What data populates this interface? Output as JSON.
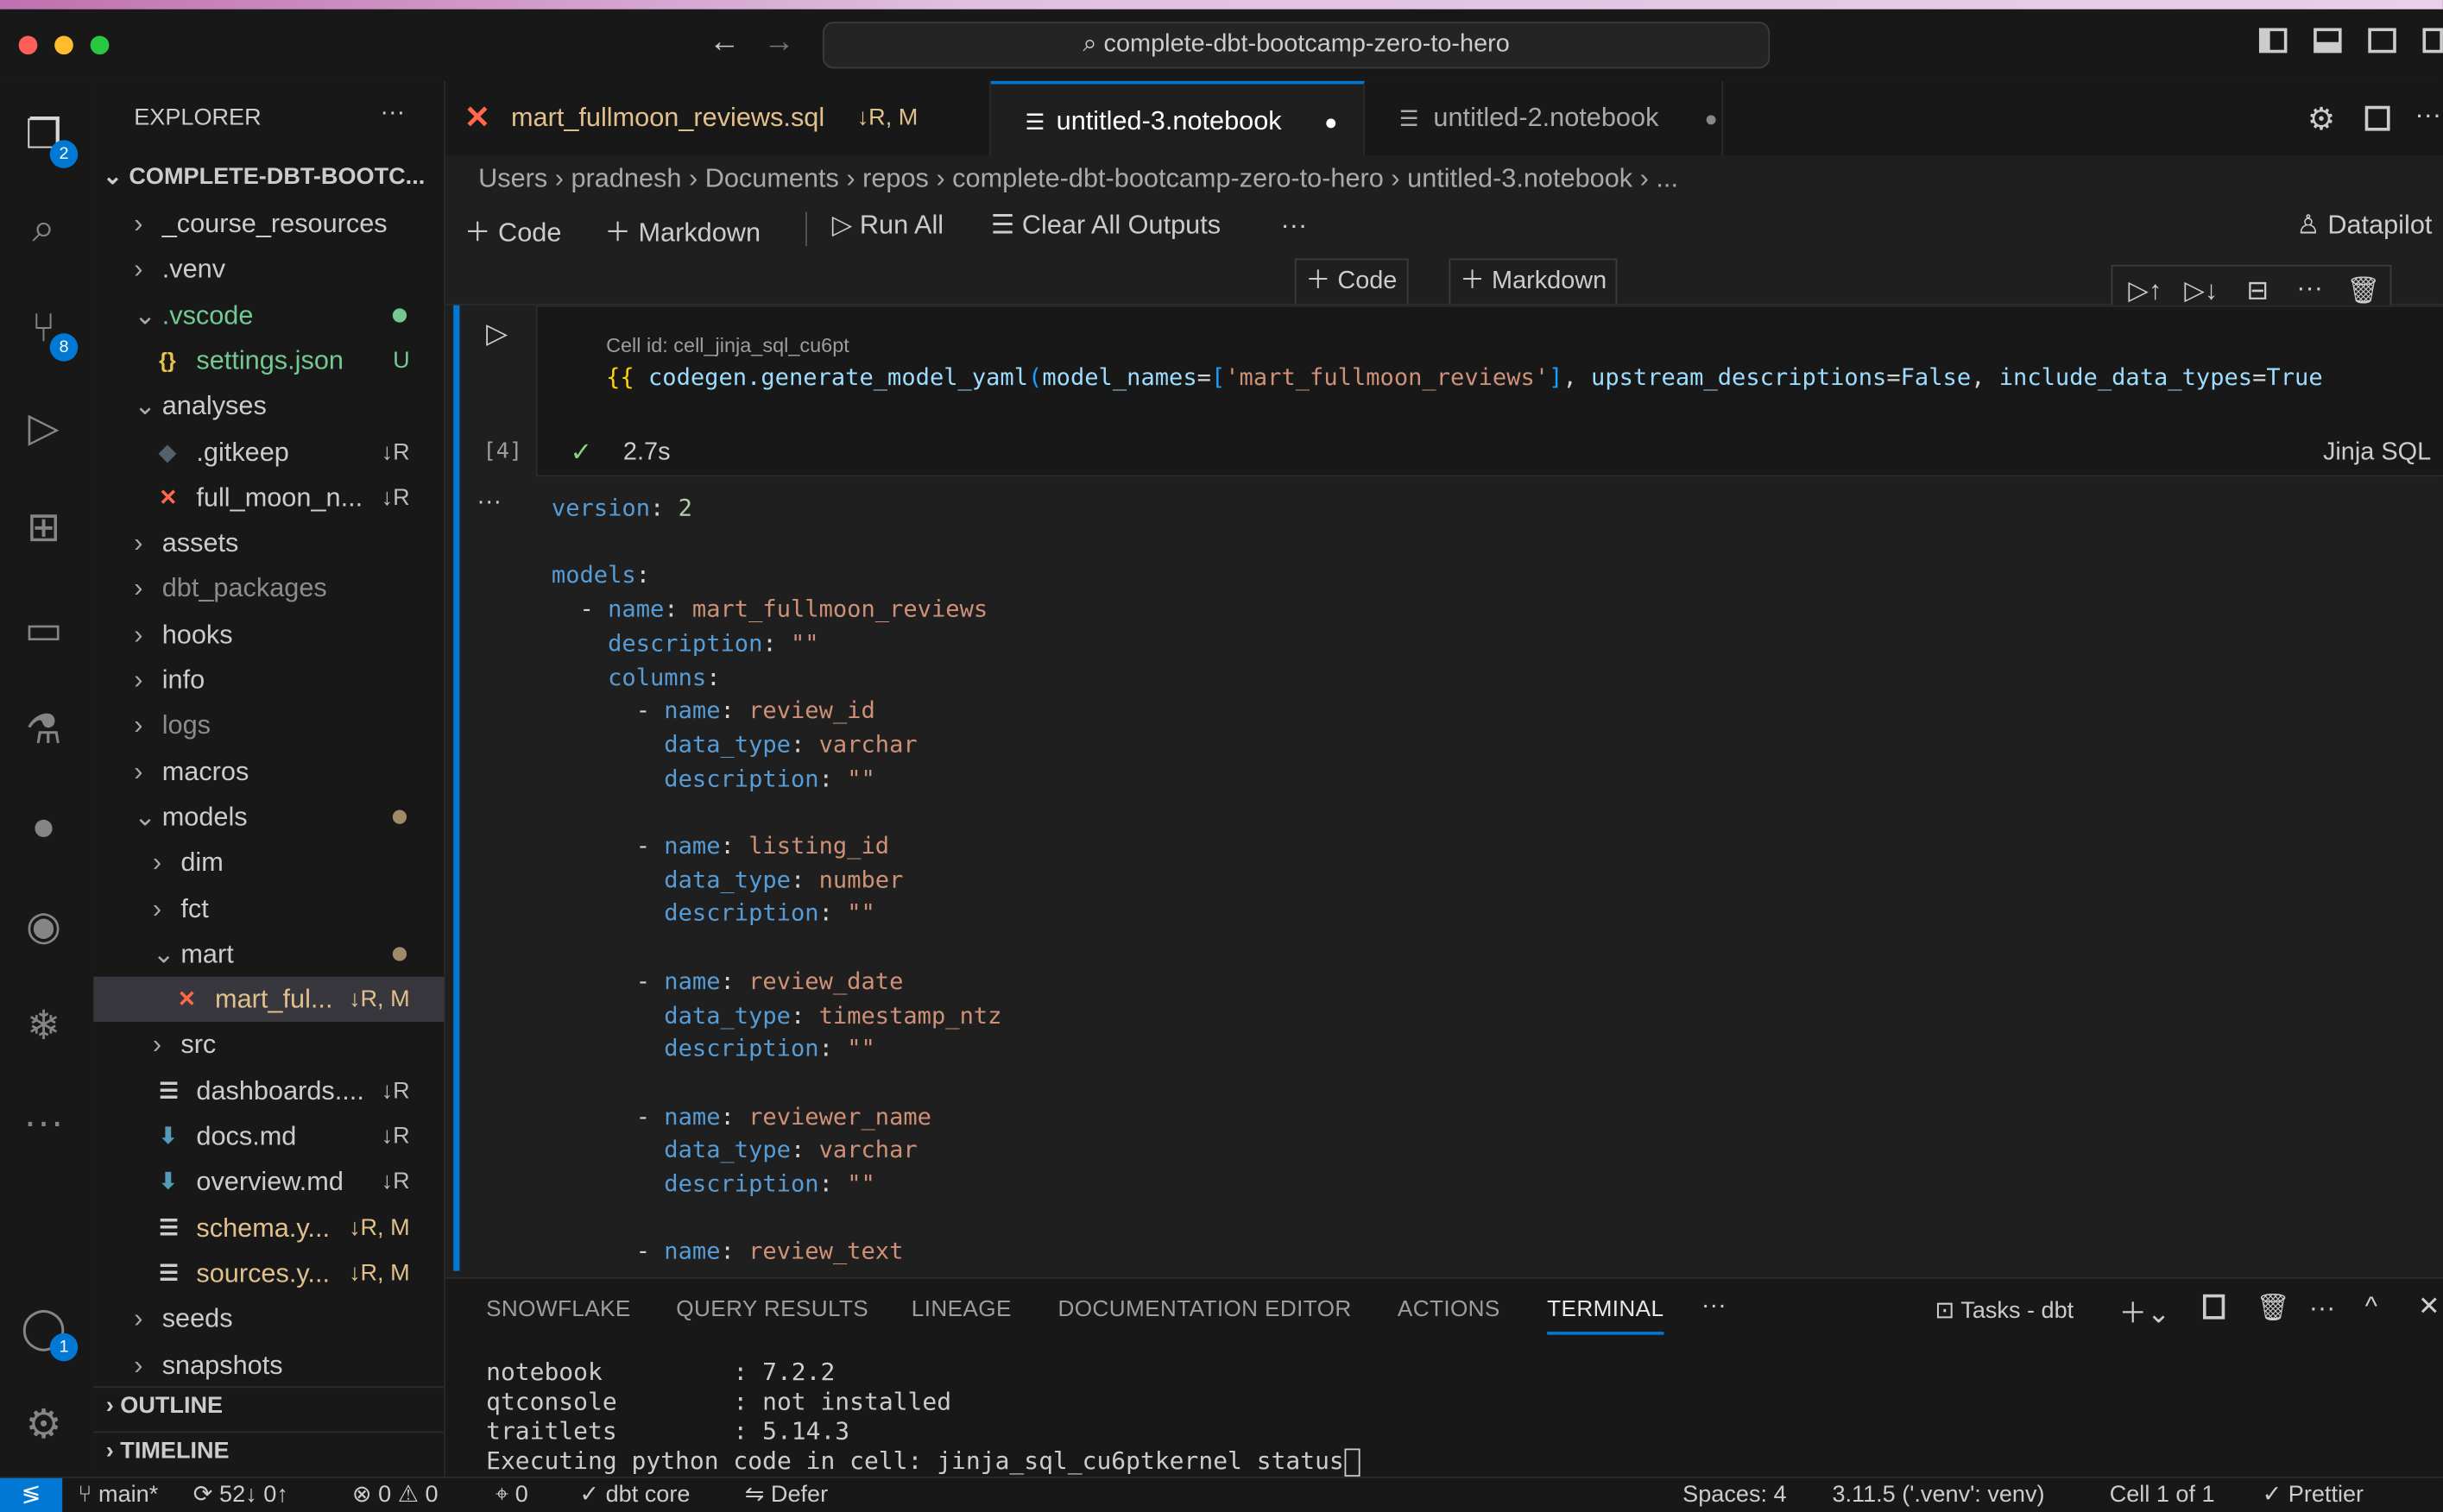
{
  "window": {
    "search": "complete-dbt-bootcamp-zero-to-hero"
  },
  "activity": {
    "explorer_badge": "2",
    "scm_badge": "8",
    "accounts_badge": "1"
  },
  "explorer": {
    "title": "EXPLORER",
    "root": "COMPLETE-DBT-BOOTC...",
    "outline": "OUTLINE",
    "timeline": "TIMELINE",
    "items": [
      {
        "label": "_course_resources",
        "indent": 0,
        "kind": "folder",
        "open": false,
        "color": "#cccccc",
        "status": ""
      },
      {
        "label": ".venv",
        "indent": 0,
        "kind": "folder",
        "open": false,
        "color": "#cccccc",
        "status": ""
      },
      {
        "label": ".vscode",
        "indent": 0,
        "kind": "folder",
        "open": true,
        "color": "#73c991",
        "status": "dot-green"
      },
      {
        "label": "settings.json",
        "indent": 1,
        "kind": "json",
        "color": "#73c991",
        "status": "U"
      },
      {
        "label": "analyses",
        "indent": 0,
        "kind": "folder",
        "open": true,
        "color": "#cccccc",
        "status": ""
      },
      {
        "label": ".gitkeep",
        "indent": 1,
        "kind": "git",
        "color": "#cccccc",
        "status": "↓R"
      },
      {
        "label": "full_moon_n...",
        "indent": 1,
        "kind": "dbt",
        "color": "#cccccc",
        "status": "↓R"
      },
      {
        "label": "assets",
        "indent": 0,
        "kind": "folder",
        "open": false,
        "color": "#cccccc",
        "status": ""
      },
      {
        "label": "dbt_packages",
        "indent": 0,
        "kind": "folder",
        "open": false,
        "color": "#8c8c8c",
        "status": ""
      },
      {
        "label": "hooks",
        "indent": 0,
        "kind": "folder",
        "open": false,
        "color": "#cccccc",
        "status": ""
      },
      {
        "label": "info",
        "indent": 0,
        "kind": "folder",
        "open": false,
        "color": "#cccccc",
        "status": ""
      },
      {
        "label": "logs",
        "indent": 0,
        "kind": "folder",
        "open": false,
        "color": "#8c8c8c",
        "status": ""
      },
      {
        "label": "macros",
        "indent": 0,
        "kind": "folder",
        "open": false,
        "color": "#cccccc",
        "status": ""
      },
      {
        "label": "models",
        "indent": 0,
        "kind": "folder",
        "open": true,
        "color": "#cccccc",
        "status": "dot-brown"
      },
      {
        "label": "dim",
        "indent": 1,
        "kind": "folder",
        "open": false,
        "color": "#cccccc",
        "status": ""
      },
      {
        "label": "fct",
        "indent": 1,
        "kind": "folder",
        "open": false,
        "color": "#cccccc",
        "status": ""
      },
      {
        "label": "mart",
        "indent": 1,
        "kind": "folder",
        "open": true,
        "color": "#cccccc",
        "status": "dot-brown"
      },
      {
        "label": "mart_ful...",
        "indent": 2,
        "kind": "dbt",
        "color": "#e2c08d",
        "status": "↓R, M",
        "selected": true
      },
      {
        "label": "src",
        "indent": 1,
        "kind": "folder",
        "open": false,
        "color": "#cccccc",
        "status": ""
      },
      {
        "label": "dashboards....",
        "indent": 1,
        "kind": "lines",
        "color": "#cccccc",
        "status": "↓R"
      },
      {
        "label": "docs.md",
        "indent": 1,
        "kind": "md",
        "color": "#cccccc",
        "status": "↓R"
      },
      {
        "label": "overview.md",
        "indent": 1,
        "kind": "md",
        "color": "#cccccc",
        "status": "↓R"
      },
      {
        "label": "schema.y...",
        "indent": 1,
        "kind": "lines",
        "color": "#e2c08d",
        "status": "↓R, M"
      },
      {
        "label": "sources.y...",
        "indent": 1,
        "kind": "lines",
        "color": "#e2c08d",
        "status": "↓R, M"
      },
      {
        "label": "seeds",
        "indent": 0,
        "kind": "folder",
        "open": false,
        "color": "#cccccc",
        "status": ""
      },
      {
        "label": "snapshots",
        "indent": 0,
        "kind": "folder",
        "open": false,
        "color": "#cccccc",
        "status": ""
      }
    ]
  },
  "tabs": [
    {
      "label": "mart_fullmoon_reviews.sql",
      "status": "↓R, M",
      "active": false
    },
    {
      "label": "untitled-3.notebook",
      "status": "●",
      "active": true
    },
    {
      "label": "untitled-2.notebook",
      "status": "●",
      "active": false
    }
  ],
  "breadcrumb": [
    "Users",
    "pradnesh",
    "Documents",
    "repos",
    "complete-dbt-bootcamp-zero-to-hero",
    "untitled-3.notebook",
    "..."
  ],
  "toolbar": {
    "code": "Code",
    "markdown": "Markdown",
    "run_all": "Run All",
    "clear": "Clear All Outputs",
    "more": "···",
    "datapilot": "Datapilot"
  },
  "cell": {
    "insert_code": "Code",
    "insert_markdown": "Markdown",
    "id": "Cell id: cell_jinja_sql_cu6pt",
    "exec_count": "[4]",
    "duration": "2.7s",
    "language": "Jinja SQL",
    "source": {
      "open": "{{",
      "fn": "codegen.generate_model_yaml",
      "arg1": "model_names",
      "str": "'mart_fullmoon_reviews'",
      "arg2": "upstream_descriptions",
      "v2": "False",
      "arg3": "include_data_types",
      "v3": "True"
    },
    "output": {
      "version_key": "version",
      "version": "2",
      "models_key": "models",
      "name_key": "name",
      "model_name": "mart_fullmoon_reviews",
      "description_key": "description",
      "empty": "\"\"",
      "columns_key": "columns",
      "data_type_key": "data_type",
      "columns": [
        {
          "name": "review_id",
          "type": "varchar"
        },
        {
          "name": "listing_id",
          "type": "number"
        },
        {
          "name": "review_date",
          "type": "timestamp_ntz"
        },
        {
          "name": "reviewer_name",
          "type": "varchar"
        },
        {
          "name": "review_text",
          "type": ""
        }
      ]
    }
  },
  "panel": {
    "tabs": [
      "SNOWFLAKE",
      "QUERY RESULTS",
      "LINEAGE",
      "DOCUMENTATION EDITOR",
      "ACTIONS",
      "TERMINAL"
    ],
    "active": "TERMINAL",
    "task": "Tasks - dbt",
    "terminal": [
      "notebook         : 7.2.2",
      "qtconsole        : not installed",
      "traitlets        : 5.14.3",
      "Executing python code in cell: jinja_sql_cu6ptkernel status"
    ]
  },
  "status": {
    "branch": "main*",
    "sync": "52↓ 0↑",
    "errors": "0",
    "warnings": "0",
    "ports": "0",
    "dbt": "dbt core",
    "defer": "Defer",
    "spaces": "Spaces: 4",
    "python": "3.11.5 ('.venv': venv)",
    "cell": "Cell 1 of 1",
    "prettier": "Prettier"
  },
  "colors": {
    "accent": "#0078d4",
    "modified": "#e2c08d",
    "untracked": "#73c991",
    "dbt": "#ff694a"
  }
}
